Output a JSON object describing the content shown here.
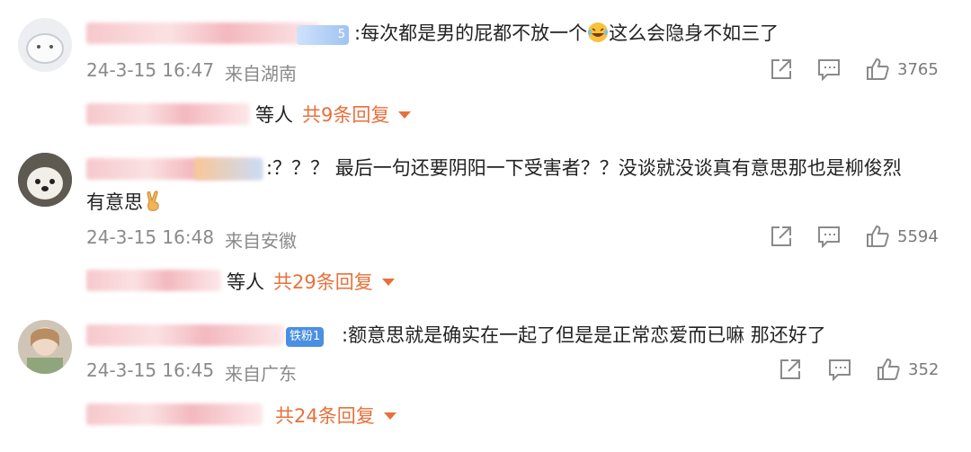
{
  "comments": [
    {
      "text": ":每次都是男的屁都不放一个",
      "text_tail": "这么会隐身不如三了",
      "date": "24-3-15 16:47",
      "location": "来自湖南",
      "likes": "3765",
      "reply_who": "等人",
      "reply_count": "共9条回复",
      "badge": "5"
    },
    {
      "text": ":？？？ 最后一句还要阴阳一下受害者？？没谈就没谈真有意思那也是柳俊烈",
      "text_line2": "有意思",
      "date": "24-3-15 16:48",
      "location": "来自安徽",
      "likes": "5594",
      "reply_who": "等人",
      "reply_count": "共29条回复"
    },
    {
      "text": ":额意思就是确实在一起了但是是正常恋爱而已嘛 那还好了",
      "date": "24-3-15 16:45",
      "location": "来自广东",
      "likes": "352",
      "reply_who": "",
      "reply_count": "共24条回复",
      "badge": "铁粉1"
    }
  ],
  "icons": {
    "share": "share-icon",
    "comment": "comment-icon",
    "like": "thumbs-up-icon"
  },
  "colors": {
    "accent": "#e8703a",
    "meta": "#8a8a8a"
  }
}
